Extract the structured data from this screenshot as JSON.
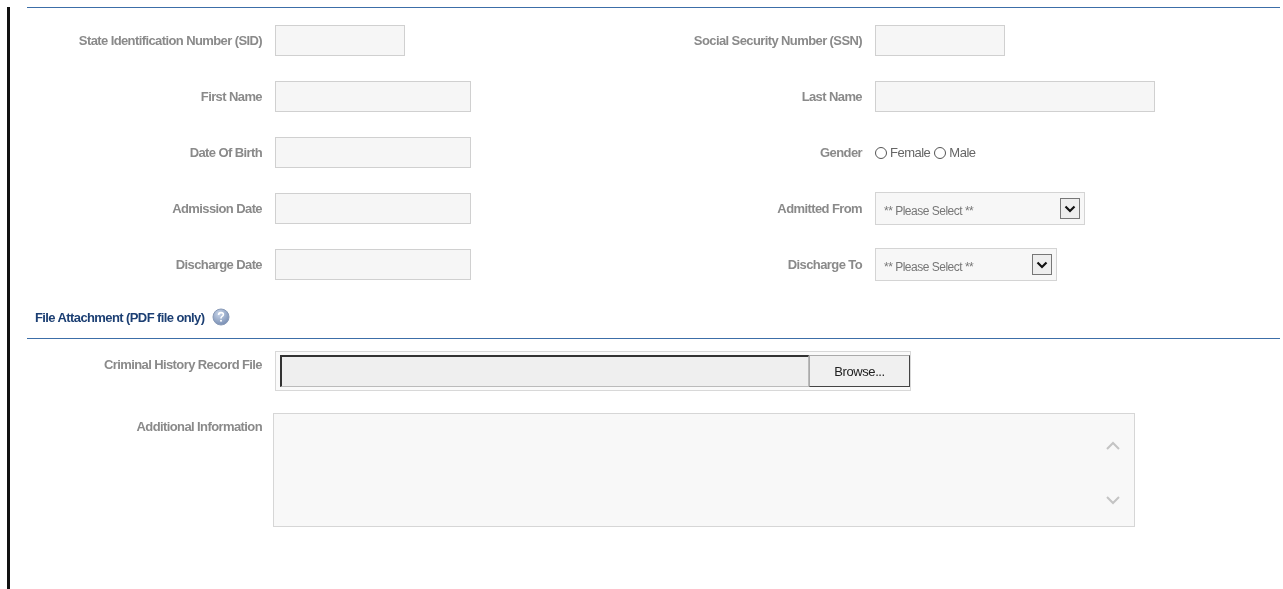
{
  "rows": [
    {
      "left": {
        "label": "State Identification Number (SID)",
        "kind": "text"
      },
      "right": {
        "label": "Social Security Number (SSN)",
        "kind": "text"
      }
    },
    {
      "left": {
        "label": "First Name",
        "kind": "text"
      },
      "right": {
        "label": "Last Name",
        "kind": "text"
      }
    },
    {
      "left": {
        "label": "Date Of Birth",
        "kind": "text"
      },
      "right": {
        "label": "Gender",
        "kind": "radio",
        "options": [
          {
            "label": "Female",
            "selected": false
          },
          {
            "label": "Male",
            "selected": false
          }
        ]
      }
    },
    {
      "left": {
        "label": "Admission Date",
        "kind": "text"
      },
      "right": {
        "label": "Admitted From",
        "kind": "select",
        "value": "** Please Select **"
      }
    },
    {
      "left": {
        "label": "Discharge Date",
        "kind": "text"
      },
      "right": {
        "label": "Discharge To",
        "kind": "select",
        "value": "** Please Select **"
      }
    }
  ],
  "attachment": {
    "heading": "File Attachment (PDF file only)",
    "file": {
      "label": "Criminal History Record File",
      "button": "Browse..."
    },
    "notes": {
      "label": "Additional Information"
    }
  }
}
